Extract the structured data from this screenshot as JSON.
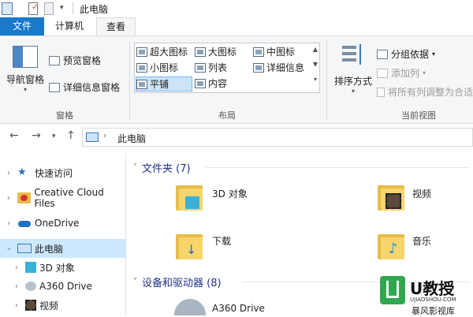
{
  "window": {
    "title": "此电脑"
  },
  "tabs": {
    "file": "文件",
    "computer": "计算机",
    "view": "查看"
  },
  "ribbon": {
    "pane": {
      "nav_pane": "导航窗格",
      "preview_pane": "预览窗格",
      "details_pane": "详细信息窗格",
      "label": "窗格"
    },
    "layout": {
      "items": [
        "超大图标",
        "大图标",
        "中图标",
        "小图标",
        "列表",
        "详细信息",
        "平铺",
        "内容"
      ],
      "selected": "平铺",
      "label": "布局"
    },
    "current_view": {
      "sort_by": "排序方式",
      "group_by": "分组依据",
      "add_column": "添加列",
      "fit_columns": "将所有列调整为合适",
      "label": "当前视图"
    }
  },
  "address": {
    "path": "此电脑"
  },
  "nav": {
    "items": [
      {
        "label": "快速访问",
        "icon": "star-icon"
      },
      {
        "label": "Creative Cloud Files",
        "icon": "creative-cloud-icon"
      },
      {
        "label": "OneDrive",
        "icon": "cloud-icon"
      },
      {
        "label": "此电脑",
        "icon": "computer-icon"
      },
      {
        "label": "3D 对象",
        "icon": "cube-icon"
      },
      {
        "label": "A360 Drive",
        "icon": "drive-icon"
      },
      {
        "label": "视频",
        "icon": "video-icon"
      }
    ]
  },
  "content": {
    "folders_header": "文件夹 (7)",
    "folders": [
      "3D 对象",
      "视频",
      "下载",
      "音乐"
    ],
    "devices_header": "设备和驱动器 (8)",
    "devices": [
      "A360 Drive",
      "暴风影视库"
    ]
  },
  "watermark": {
    "brand": "U教授",
    "url": "UJIAOSHOU.COM"
  },
  "colors": {
    "accent": "#1979ca",
    "selected_bg": "#cce8ff",
    "section_text": "#1e3287"
  }
}
